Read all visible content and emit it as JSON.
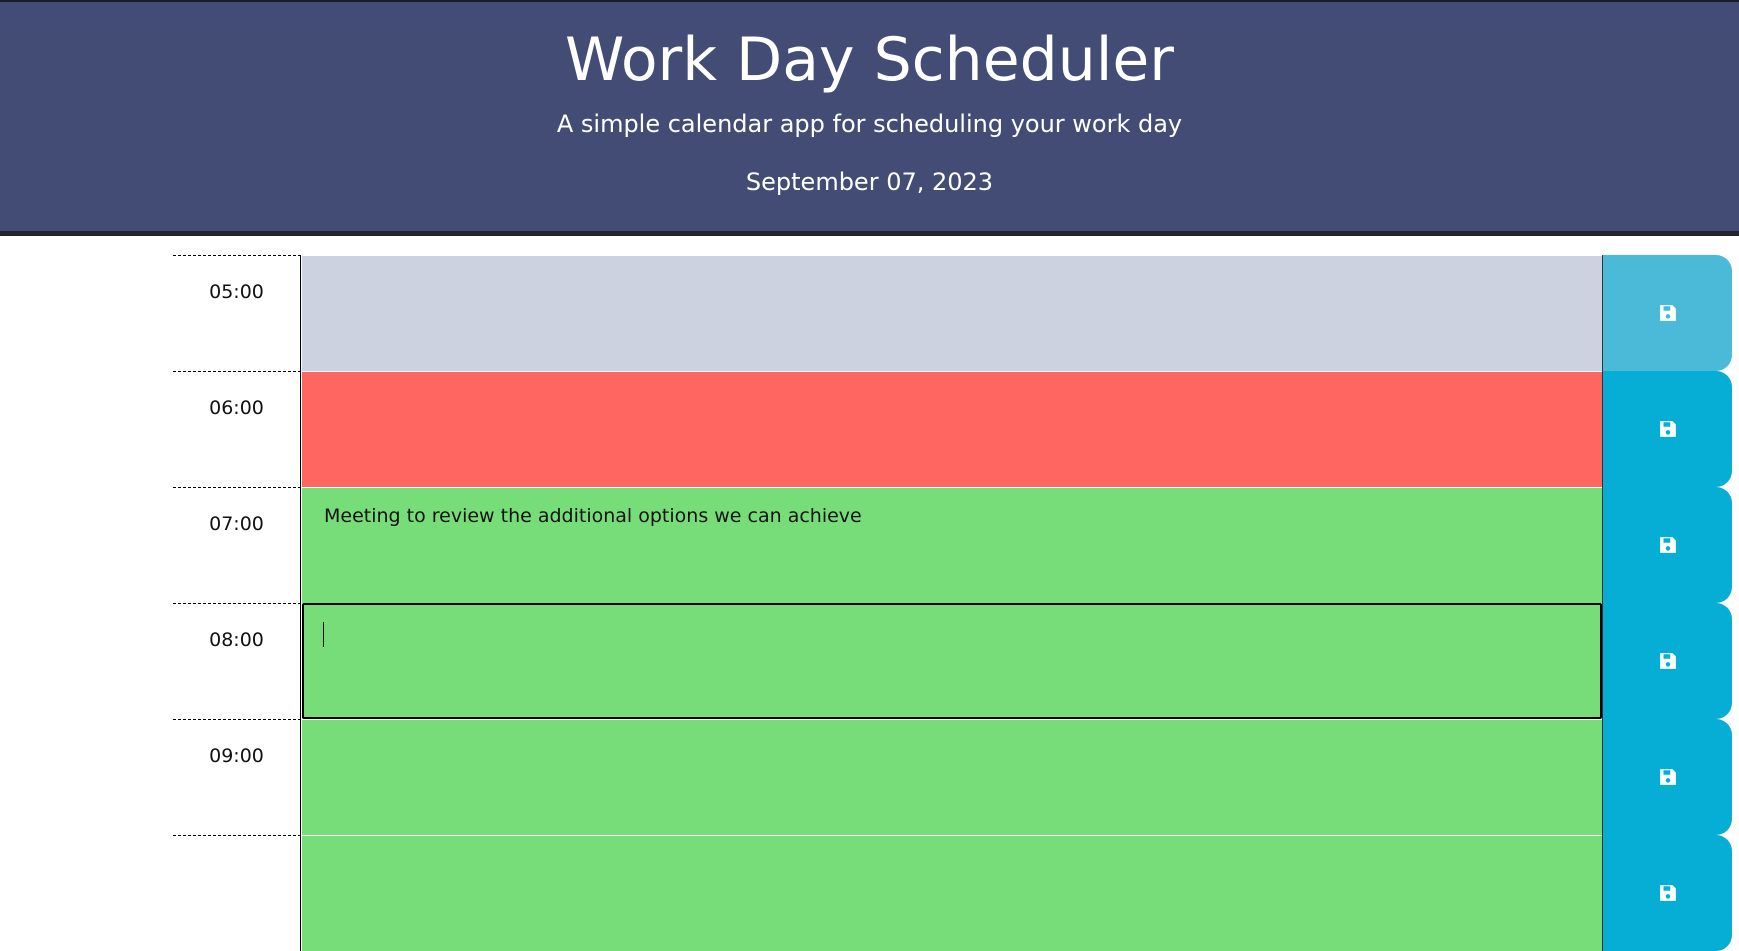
{
  "header": {
    "title": "Work Day Scheduler",
    "subtitle": "A simple calendar app for scheduling your work day",
    "date": "September 07, 2023"
  },
  "colors": {
    "header_bg": "#434c74",
    "past": "#cdd2e0",
    "present": "#ff6661",
    "future": "#77dd78",
    "save_button": "#06aed5"
  },
  "save_icon": "save-icon",
  "time_blocks": [
    {
      "hour": "05:00",
      "status": "past",
      "text": ""
    },
    {
      "hour": "06:00",
      "status": "present",
      "text": ""
    },
    {
      "hour": "07:00",
      "status": "future",
      "text": "Meeting to review the additional options we can achieve"
    },
    {
      "hour": "08:00",
      "status": "future",
      "text": ""
    },
    {
      "hour": "09:00",
      "status": "future",
      "text": ""
    },
    {
      "hour": "",
      "status": "future",
      "text": ""
    }
  ]
}
